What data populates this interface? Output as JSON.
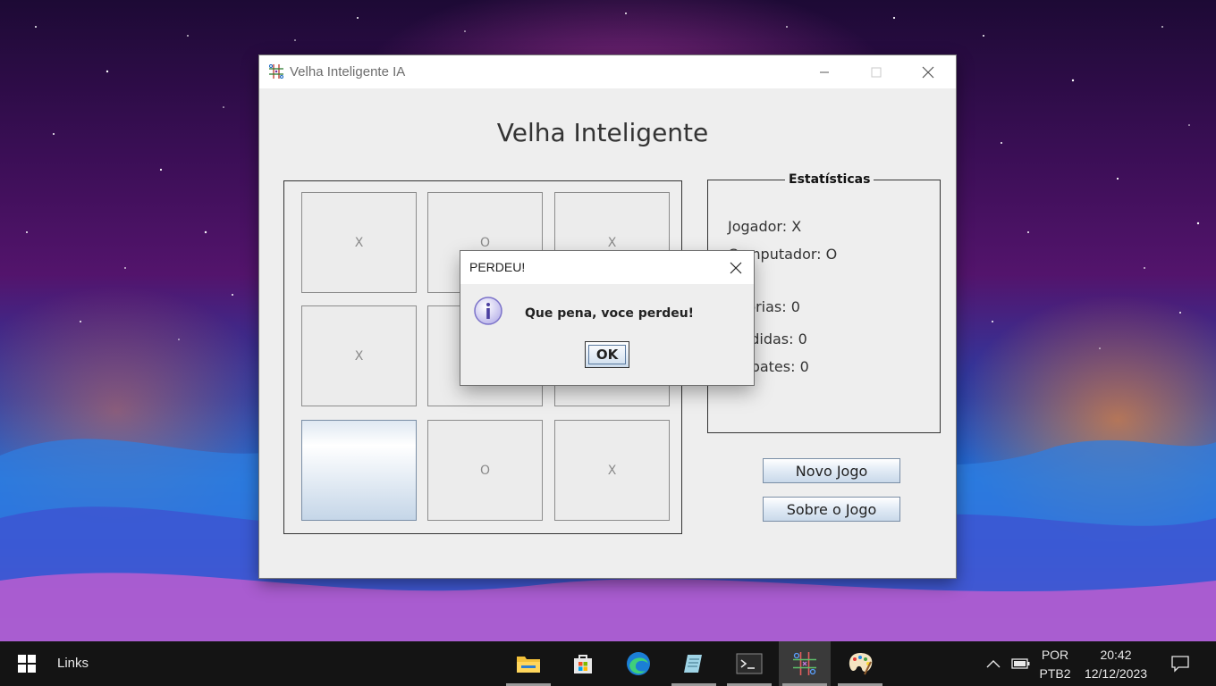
{
  "window": {
    "title": "Velha Inteligente IA",
    "heading": "Velha Inteligente"
  },
  "board": {
    "cells": [
      "X",
      "O",
      "X",
      "X",
      "",
      "",
      "",
      "O",
      "X"
    ]
  },
  "stats": {
    "legend": "Estatísticas",
    "player": "Jogador: X",
    "computer": "Computador: O",
    "wins": "Vitórias: 0",
    "losses": "Perdidas: 0",
    "draws": "Empates: 0"
  },
  "buttons": {
    "new_game": "Novo Jogo",
    "about": "Sobre o Jogo"
  },
  "dialog": {
    "title": "PERDEU!",
    "message": "Que pena, voce perdeu!",
    "ok": "OK"
  },
  "taskbar": {
    "links_label": "Links",
    "language_top": "POR",
    "language_bottom": "PTB2",
    "time": "20:42",
    "date": "12/12/2023",
    "apps": [
      "file-explorer-icon",
      "microsoft-store-icon",
      "edge-icon",
      "notepad-icon",
      "terminal-icon",
      "tic-tac-toe-icon",
      "paint-icon"
    ]
  },
  "colors": {
    "window_bg": "#eeeeee",
    "taskbar_bg": "#141414",
    "info_icon": "#7b72c9"
  }
}
